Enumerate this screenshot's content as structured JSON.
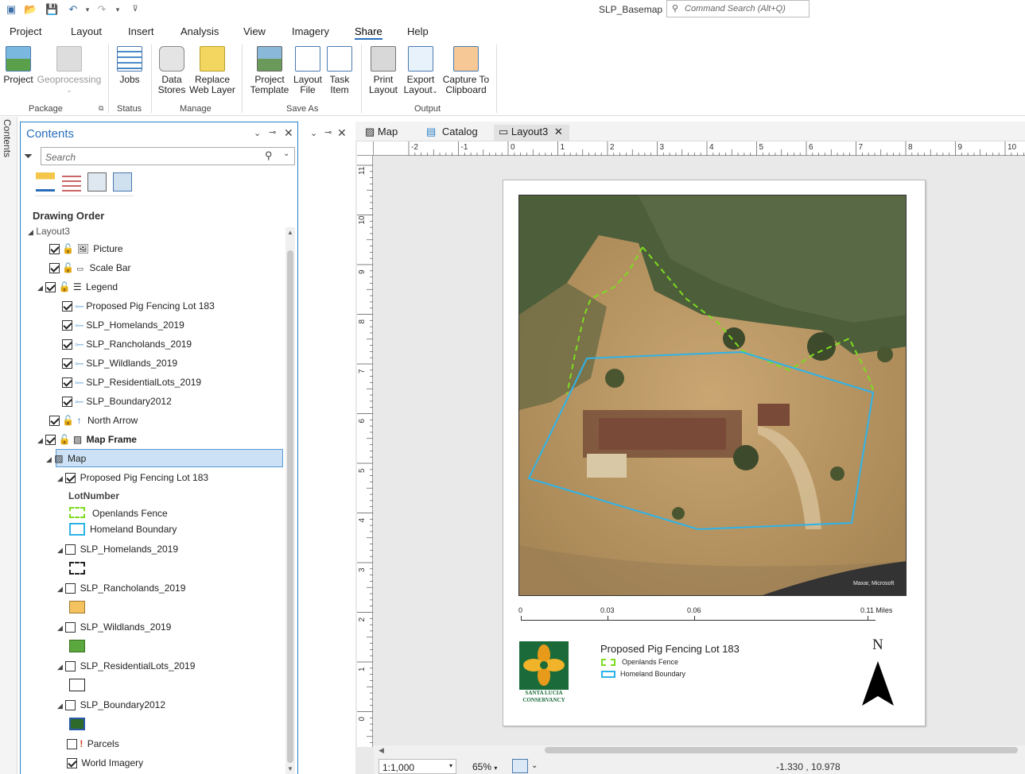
{
  "app": {
    "title": "SLP_Basemap",
    "command_search_placeholder": "Command Search (Alt+Q)"
  },
  "ribbon_tabs": [
    "Project",
    "Layout",
    "Insert",
    "Analysis",
    "View",
    "Imagery",
    "Share",
    "Help"
  ],
  "ribbon": {
    "package": {
      "label": "Package",
      "project": "Project",
      "geoprocessing": "Geoprocessing"
    },
    "status": {
      "label": "Status",
      "jobs": "Jobs"
    },
    "manage": {
      "label": "Manage",
      "data_stores_1": "Data",
      "data_stores_2": "Stores",
      "replace_1": "Replace",
      "replace_2": "Web Layer"
    },
    "save_as": {
      "label": "Save As",
      "pt_1": "Project",
      "pt_2": "Template",
      "lf_1": "Layout",
      "lf_2": "File",
      "ti_1": "Task",
      "ti_2": "Item"
    },
    "output": {
      "label": "Output",
      "print_1": "Print",
      "print_2": "Layout",
      "export_1": "Export",
      "export_2": "Layout",
      "capture_1": "Capture To",
      "capture_2": "Clipboard"
    }
  },
  "side_tab": "Contents",
  "contents": {
    "title": "Contents",
    "search_placeholder": "Search",
    "drawing_order": "Drawing Order",
    "tree": {
      "layout": "Layout3",
      "picture": "Picture",
      "scale_bar": "Scale Bar",
      "legend": "Legend",
      "legend_items": [
        "Proposed Pig Fencing Lot 183",
        "SLP_Homelands_2019",
        "SLP_Rancholands_2019",
        "SLP_Wildlands_2019",
        "SLP_ResidentialLots_2019",
        "SLP_Boundary2012"
      ],
      "north_arrow": "North Arrow",
      "map_frame": "Map Frame",
      "map": "Map",
      "pig": "Proposed Pig Fencing Lot 183",
      "lot_number": "LotNumber",
      "openlands": "Openlands Fence",
      "homeland": "Homeland Boundary",
      "homelands": "SLP_Homelands_2019",
      "rancholands": "SLP_Rancholands_2019",
      "wildlands": "SLP_Wildlands_2019",
      "residential": "SLP_ResidentialLots_2019",
      "boundary": "SLP_Boundary2012",
      "parcels": "Parcels",
      "imagery": "World Imagery"
    }
  },
  "doc_tabs": {
    "map": "Map",
    "catalog": "Catalog",
    "layout": "Layout3"
  },
  "ruler_h": [
    "-2",
    "-1",
    "0",
    "1",
    "2",
    "3",
    "4",
    "5",
    "6",
    "7",
    "8",
    "9",
    "10"
  ],
  "ruler_v": [
    "11",
    "10",
    "9",
    "8",
    "7",
    "6",
    "5",
    "4",
    "3",
    "2",
    "1",
    "0"
  ],
  "layout_page": {
    "scalebar": {
      "t0": "0",
      "t1": "0.03",
      "t2": "0.06",
      "t3": "0.11 Miles"
    },
    "legend_title": "Proposed Pig Fencing Lot 183",
    "legend_openlands": "Openlands Fence",
    "legend_homeland": "Homeland Boundary",
    "north": "N",
    "logo_1": "SANTA LUCIA",
    "logo_2": "CONSERVANCY",
    "credit": "Maxar, Microsoft"
  },
  "status": {
    "scale": "1:1,000",
    "zoom": "65%",
    "coords": "-1.330 , 10.978"
  },
  "colors": {
    "accent": "#2a6ebb",
    "fence": "#7ddc1f",
    "boundary": "#2eb3e8",
    "selection": "#cce1f5"
  }
}
